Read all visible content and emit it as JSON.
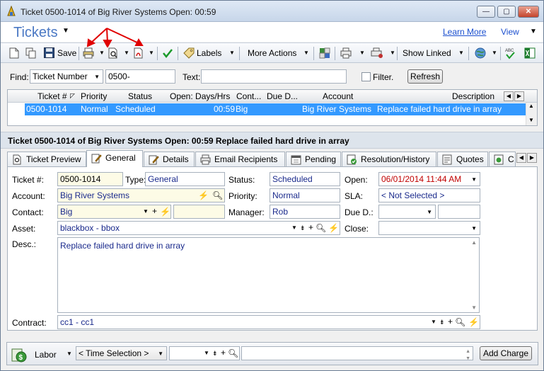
{
  "window": {
    "title": "Ticket 0500-1014 of Big River Systems Open:  00:59",
    "minimize_glyph": "—",
    "maximize_glyph": "▢",
    "close_glyph": "✕"
  },
  "header": {
    "module": "Tickets",
    "learn_more": "Learn More",
    "view": "View"
  },
  "toolbar": {
    "save_label": "Save",
    "labels_label": "Labels",
    "more_actions_label": "More Actions",
    "show_linked_label": "Show Linked"
  },
  "find": {
    "find_label": "Find:",
    "field": "Ticket Number",
    "value": "0500-",
    "text_label": "Text:",
    "text_value": "",
    "filter_label": "Filter.",
    "refresh_label": "Refresh"
  },
  "grid": {
    "columns": [
      "Ticket #",
      "Priority",
      "Status",
      "Open: Days/Hrs",
      "Cont...",
      "Due D...",
      "Account",
      "Description"
    ],
    "rows": [
      {
        "ticket": "0500-1014",
        "priority": "Normal",
        "status": "Scheduled",
        "open": "00:59",
        "contact": "Big",
        "due": "",
        "account": "Big River Systems",
        "description": "Replace failed hard drive in array"
      }
    ]
  },
  "summary": "Ticket 0500-1014 of Big River Systems Open:   00:59 Replace failed hard drive in array",
  "tabs": [
    "Ticket Preview",
    "General",
    "Details",
    "Email Recipients",
    "Pending",
    "Resolution/History",
    "Quotes",
    "C"
  ],
  "form": {
    "ticket_label": "Ticket #:",
    "ticket_value": "0500-1014",
    "type_label": "Type:",
    "type_value": "General",
    "status_label": "Status:",
    "status_value": "Scheduled",
    "open_label": "Open:",
    "open_value": "06/01/2014  11:44 AM",
    "account_label": "Account:",
    "account_value": "Big River Systems",
    "priority_label": "Priority:",
    "priority_value": "Normal",
    "sla_label": "SLA:",
    "sla_value": "< Not Selected >",
    "contact_label": "Contact:",
    "contact_value": "Big",
    "manager_label": "Manager:",
    "manager_value": "Rob",
    "due_label": "Due D.:",
    "asset_label": "Asset:",
    "asset_value": "blackbox - bbox",
    "close_label": "Close:",
    "desc_label": "Desc.:",
    "desc_value": "Replace failed hard drive in array",
    "contract_label": "Contract:",
    "contract_value": "cc1 - cc1"
  },
  "bottom": {
    "labor_label": "Labor",
    "time_selection": "< Time Selection >",
    "add_charge_label": "Add Charge"
  }
}
